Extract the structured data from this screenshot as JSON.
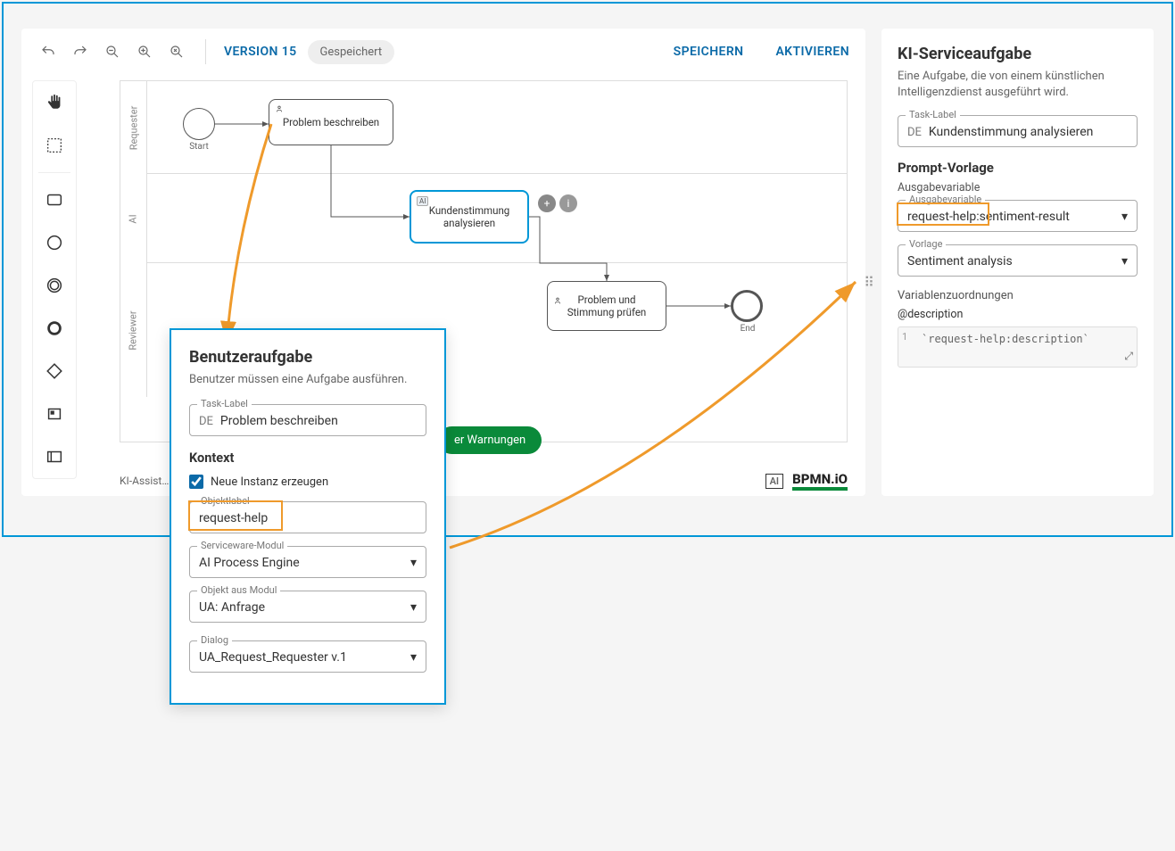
{
  "toolbar": {
    "version": "VERSION 15",
    "saved_pill": "Gespeichert",
    "save_btn": "SPEICHERN",
    "activate_btn": "AKTIVIEREN"
  },
  "lanes": [
    "Requester",
    "AI",
    "Reviewer"
  ],
  "bpmn": {
    "start_label": "Start",
    "end_label": "End",
    "task_describe": "Problem beschreiben",
    "task_sentiment": "Kundenstimmung\nanalysieren",
    "task_review": "Problem und\nStimmung prüfen",
    "warnings_btn": "er Warnungen"
  },
  "footer": {
    "assist": "KI-Assist…",
    "ai_logo": "AI",
    "bpmn_logo": "BPMN.iO"
  },
  "right": {
    "title": "KI-Serviceaufgabe",
    "subtitle": "Eine Aufgabe, die von einem künstlichen Intelligenzdienst ausgeführt wird.",
    "task_label_legend": "Task-Label",
    "lang": "DE",
    "task_label_value": "Kundenstimmung analysieren",
    "prompt_heading": "Prompt-Vorlage",
    "outvar_label": "Ausgabevariable",
    "outvar_legend": "Ausgabevariable",
    "outvar_value": "request-help:sentiment-result",
    "template_legend": "Vorlage",
    "template_value": "Sentiment analysis",
    "mappings_heading": "Variablenzuordnungen",
    "mapping_var": "@description",
    "mapping_code": "`request-help:description`"
  },
  "popup": {
    "title": "Benutzeraufgabe",
    "subtitle": "Benutzer müssen eine Aufgabe ausführen.",
    "task_label_legend": "Task-Label",
    "lang": "DE",
    "task_label_value": "Problem beschreiben",
    "context_heading": "Kontext",
    "new_instance": "Neue Instanz erzeugen",
    "objlabel_legend": "Objektlabel",
    "objlabel_value": "request-help",
    "module_legend": "Serviceware-Modul",
    "module_value": "AI Process Engine",
    "obj_from_module_legend": "Objekt aus Modul",
    "obj_from_module_value": "UA: Anfrage",
    "dialog_legend": "Dialog",
    "dialog_value": "UA_Request_Requester v.1"
  },
  "highlight_request_help": "request-help",
  "highlight_request_help2": "request-help:"
}
